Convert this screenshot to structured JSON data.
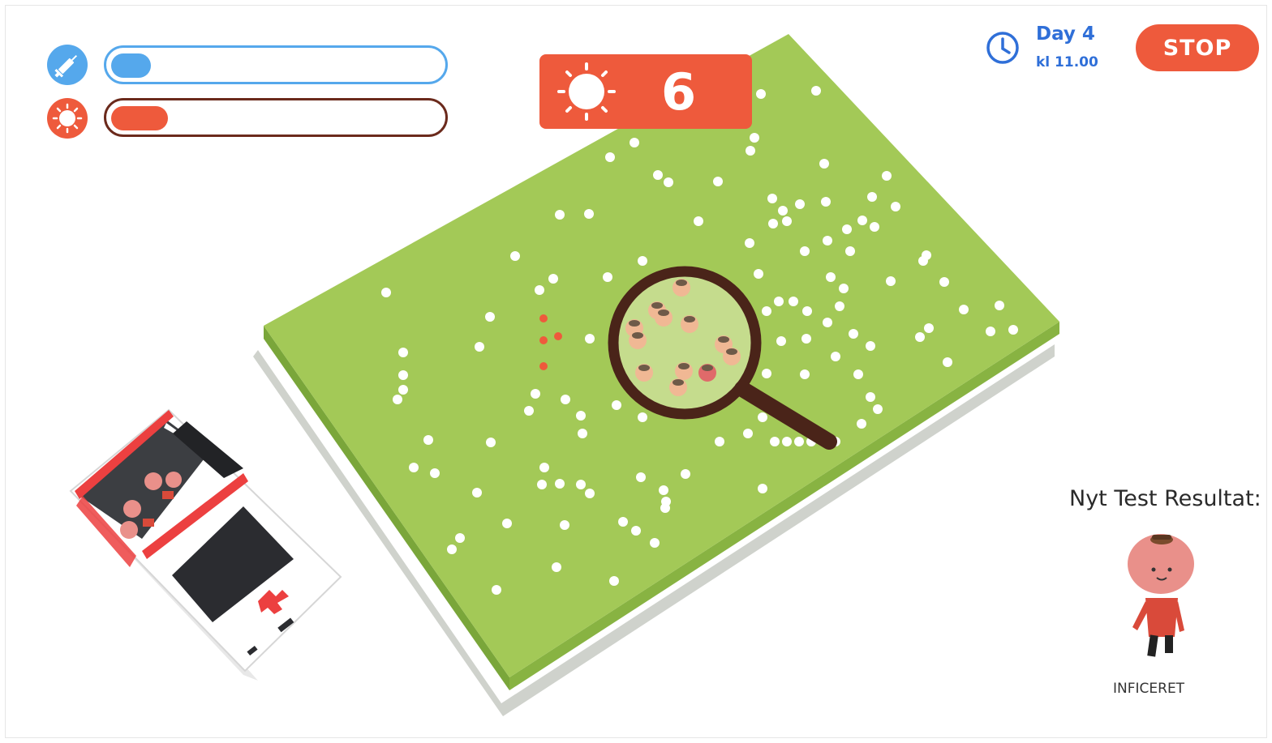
{
  "meters": {
    "vaccine": {
      "icon": "syringe-icon",
      "level": 0.12,
      "color": "#55a8ec",
      "border": "#55a8ec"
    },
    "infection": {
      "icon": "virus-icon",
      "level": 0.17,
      "color": "#ee5a3c",
      "border": "#6b2a1c"
    }
  },
  "counter": {
    "icon": "virus-icon",
    "value": "6"
  },
  "clock": {
    "icon": "clock-icon",
    "day": "Day 4",
    "time": "kl 11.00"
  },
  "stop_button": {
    "label": "STOP"
  },
  "result": {
    "title": "Nyt Test Resultat:",
    "status": "INFICERET"
  },
  "colors": {
    "field": "#a3c957",
    "field_edge": "#7aa63a",
    "accent_red": "#ee5a3c",
    "accent_blue": "#2f6fd8",
    "magnifier": "#4a2419"
  }
}
